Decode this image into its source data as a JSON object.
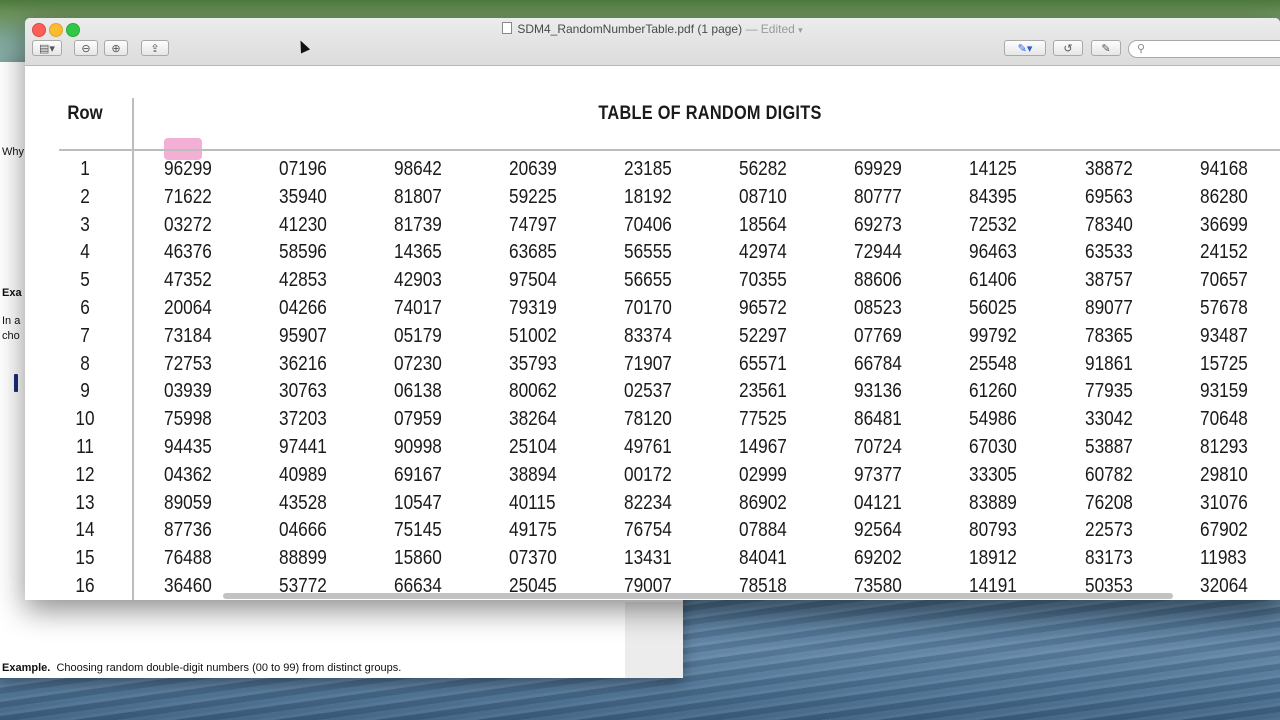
{
  "window": {
    "title": "SDM4_RandomNumberTable.pdf (1 page)",
    "status": "— Edited",
    "status_caret": "▾"
  },
  "toolbar": {
    "sidebar_btn": "▤▾",
    "zoom_out": "⊖",
    "zoom_in": "⊕",
    "share": "⇪",
    "markup_highlight": "✎▾",
    "rotate": "↺",
    "edit": "✎",
    "search_placeholder": ""
  },
  "background_doc": {
    "why": "Why",
    "exa": "Exa",
    "in_a": "In a",
    "cho": "cho",
    "caption_bold": "Example.",
    "caption_text": "Choosing random double-digit numbers (00 to 99) from distinct groups."
  },
  "table": {
    "row_header": "Row",
    "title": "TABLE OF RANDOM DIGITS",
    "rows": [
      {
        "n": "1",
        "cells": [
          "96299",
          "07196",
          "98642",
          "20639",
          "23185",
          "56282",
          "69929",
          "14125",
          "38872",
          "94168"
        ]
      },
      {
        "n": "2",
        "cells": [
          "71622",
          "35940",
          "81807",
          "59225",
          "18192",
          "08710",
          "80777",
          "84395",
          "69563",
          "86280"
        ]
      },
      {
        "n": "3",
        "cells": [
          "03272",
          "41230",
          "81739",
          "74797",
          "70406",
          "18564",
          "69273",
          "72532",
          "78340",
          "36699"
        ]
      },
      {
        "n": "4",
        "cells": [
          "46376",
          "58596",
          "14365",
          "63685",
          "56555",
          "42974",
          "72944",
          "96463",
          "63533",
          "24152"
        ]
      },
      {
        "n": "5",
        "cells": [
          "47352",
          "42853",
          "42903",
          "97504",
          "56655",
          "70355",
          "88606",
          "61406",
          "38757",
          "70657"
        ]
      },
      {
        "n": "6",
        "cells": [
          "20064",
          "04266",
          "74017",
          "79319",
          "70170",
          "96572",
          "08523",
          "56025",
          "89077",
          "57678"
        ]
      },
      {
        "n": "7",
        "cells": [
          "73184",
          "95907",
          "05179",
          "51002",
          "83374",
          "52297",
          "07769",
          "99792",
          "78365",
          "93487"
        ]
      },
      {
        "n": "8",
        "cells": [
          "72753",
          "36216",
          "07230",
          "35793",
          "71907",
          "65571",
          "66784",
          "25548",
          "91861",
          "15725"
        ]
      },
      {
        "n": "9",
        "cells": [
          "03939",
          "30763",
          "06138",
          "80062",
          "02537",
          "23561",
          "93136",
          "61260",
          "77935",
          "93159"
        ]
      },
      {
        "n": "10",
        "cells": [
          "75998",
          "37203",
          "07959",
          "38264",
          "78120",
          "77525",
          "86481",
          "54986",
          "33042",
          "70648"
        ]
      },
      {
        "n": "11",
        "cells": [
          "94435",
          "97441",
          "90998",
          "25104",
          "49761",
          "14967",
          "70724",
          "67030",
          "53887",
          "81293"
        ]
      },
      {
        "n": "12",
        "cells": [
          "04362",
          "40989",
          "69167",
          "38894",
          "00172",
          "02999",
          "97377",
          "33305",
          "60782",
          "29810"
        ]
      },
      {
        "n": "13",
        "cells": [
          "89059",
          "43528",
          "10547",
          "40115",
          "82234",
          "86902",
          "04121",
          "83889",
          "76208",
          "31076"
        ]
      },
      {
        "n": "14",
        "cells": [
          "87736",
          "04666",
          "75145",
          "49175",
          "76754",
          "07884",
          "92564",
          "80793",
          "22573",
          "67902"
        ]
      },
      {
        "n": "15",
        "cells": [
          "76488",
          "88899",
          "15860",
          "07370",
          "13431",
          "84041",
          "69202",
          "18912",
          "83173",
          "11983"
        ]
      },
      {
        "n": "16",
        "cells": [
          "36460",
          "53772",
          "66634",
          "25045",
          "79007",
          "78518",
          "73580",
          "14191",
          "50353",
          "32064"
        ]
      }
    ]
  }
}
